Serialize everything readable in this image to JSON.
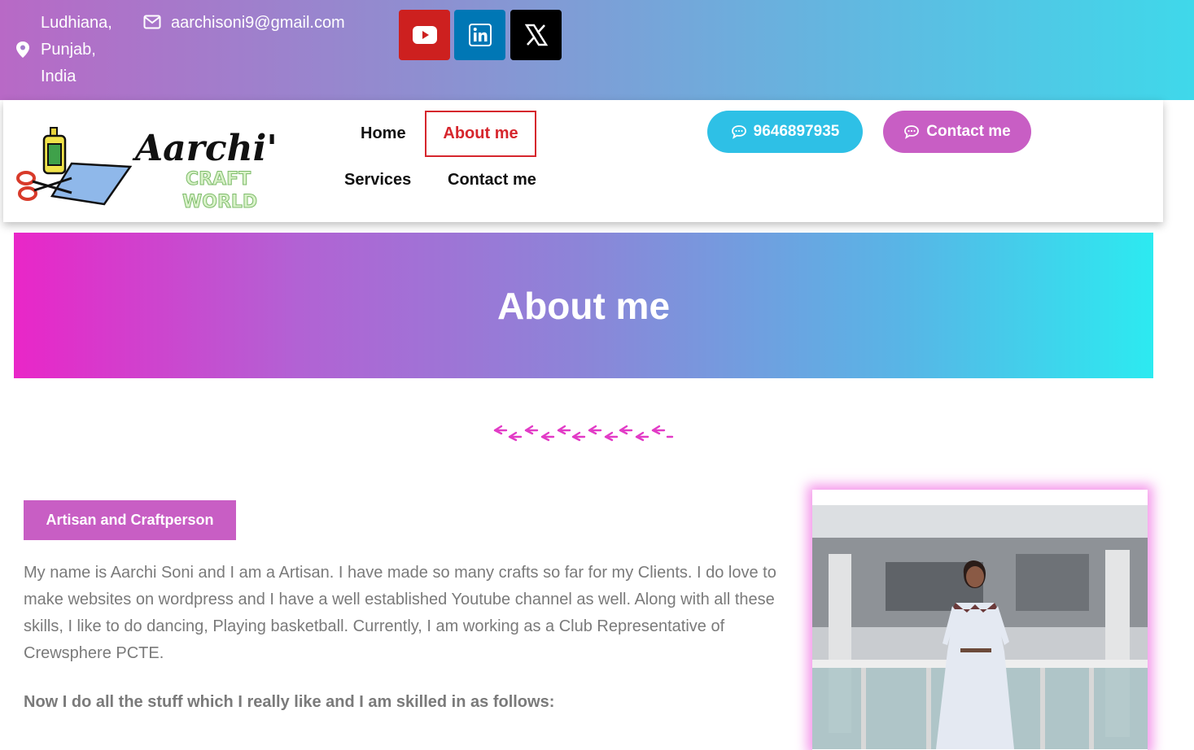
{
  "topbar": {
    "location_lines": [
      "Ludhiana,",
      "Punjab,",
      "India"
    ],
    "email": "aarchisoni9@gmail.com",
    "social": [
      {
        "name": "youtube-icon",
        "color": "#cd201f"
      },
      {
        "name": "linkedin-icon",
        "color": "#0077b5"
      },
      {
        "name": "x-icon",
        "color": "#000000"
      }
    ]
  },
  "header": {
    "logo": {
      "script": "Aarchi's",
      "line1": "CRAFT",
      "line2": "WORLD"
    },
    "nav": {
      "home": "Home",
      "about": "About me",
      "services": "Services",
      "contact": "Contact me"
    },
    "phone_button": "9646897935",
    "contact_button": "Contact me",
    "colors": {
      "phone": "#2ec0e6",
      "contact": "#c85ec4",
      "active": "#d6262d"
    }
  },
  "banner": {
    "title": "About me"
  },
  "content": {
    "tag": "Artisan and Craftperson",
    "paragraph": "My name is Aarchi Soni and I am a Artisan. I have made so many crafts so far for my Clients. I do love to make websites on wordpress and I have a well established Youtube channel as well. Along with all these skills, I like to do dancing, Playing basketball. Currently, I am working as a Club Representative of Crewsphere PCTE.",
    "subheading": "Now I do all the stuff which I really like and I am skilled in as follows:"
  }
}
